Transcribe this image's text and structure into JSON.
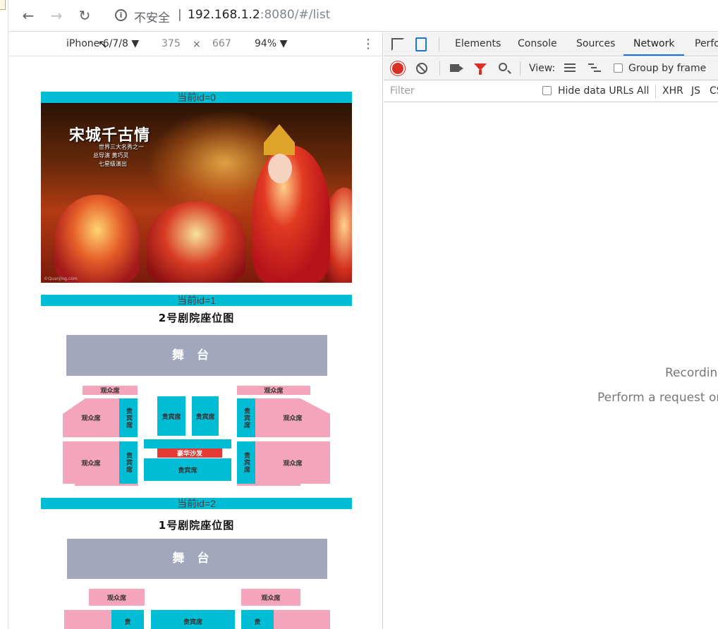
{
  "browser": {
    "security_label": "不安全",
    "separator": "|",
    "url_host": "192.168.1.2",
    "url_rest": ":8080/#/list"
  },
  "device_toolbar": {
    "device": "iPhone 6/7/8 ▼",
    "width": "375",
    "times": "×",
    "height": "667",
    "zoom": "94% ▼"
  },
  "page": {
    "items": [
      {
        "label": "当前id=0"
      },
      {
        "label": "当前id=1"
      },
      {
        "label": "当前id=2"
      }
    ],
    "poster": {
      "title": "宋城千古情",
      "line1": "世界三大名秀之一",
      "line2": "总导演   黄巧灵",
      "line3": "七星级演出",
      "watermark": "©Quanjing.com"
    },
    "seatmap_2": {
      "heading": "2号剧院座位图",
      "stage": "舞台",
      "audience": "观众席",
      "vip": "贵宾席",
      "vip_vertical": "贵宾席",
      "sofa": "豪华沙发"
    },
    "seatmap_1": {
      "heading": "1号剧院座位图",
      "stage": "舞台",
      "audience": "观众席",
      "vip": "贵宾席",
      "vip_partial": "贵"
    }
  },
  "devtools": {
    "tabs": [
      "Elements",
      "Console",
      "Sources",
      "Network",
      "Perfo"
    ],
    "active_tab": "Network",
    "view_label": "View:",
    "group_by_frame": "Group by frame",
    "filter_placeholder": "Filter",
    "hide_data_urls": "Hide data URLs",
    "type_filters": [
      "All",
      "XHR",
      "JS",
      "CS"
    ],
    "recording": "Recording",
    "perform": "Perform a request or h"
  }
}
